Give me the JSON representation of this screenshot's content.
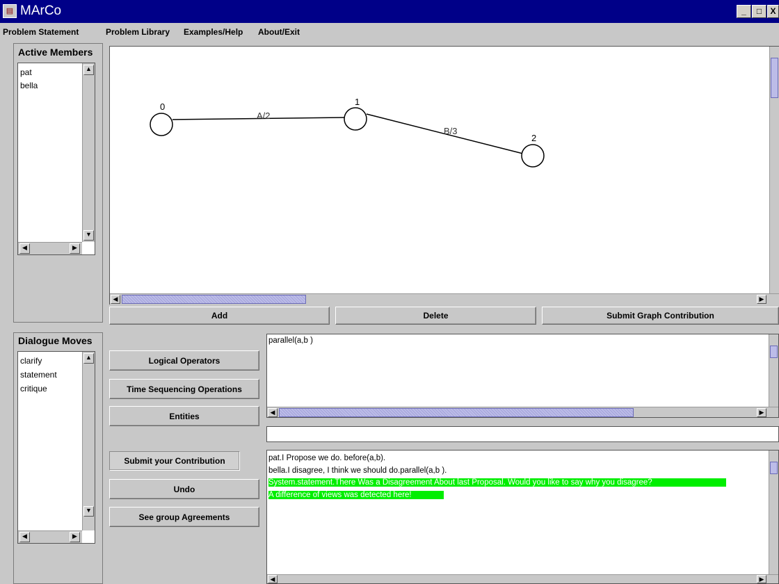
{
  "window": {
    "title": "MArCo",
    "buttons": {
      "minimize": "_",
      "maximize": "□",
      "close": "X"
    }
  },
  "menu": [
    "Problem Statement",
    "Problem Library",
    "Examples/Help",
    "About/Exit"
  ],
  "active_members": {
    "label": "Active Members",
    "items": [
      "pat",
      "bella"
    ]
  },
  "graph": {
    "nodes": [
      {
        "label": "0"
      },
      {
        "label": "1"
      },
      {
        "label": "2"
      }
    ],
    "edges": [
      {
        "label": "A/2",
        "from": "0",
        "to": "1"
      },
      {
        "label": "B/3",
        "from": "1",
        "to": "2"
      }
    ]
  },
  "graph_buttons": {
    "add": "Add",
    "delete": "Delete",
    "submit": "Submit Graph Contribution"
  },
  "dialogue_moves": {
    "label": "Dialogue Moves",
    "items": [
      "clarify",
      "statement",
      "critique"
    ]
  },
  "op_buttons": {
    "logical": "Logical Operators",
    "time": "Time Sequencing Operations",
    "entities": "Entities",
    "submit": "Submit your Contribution",
    "undo": "Undo",
    "agreements": "See group Agreements"
  },
  "expression": {
    "text": "parallel(a,b )"
  },
  "input_field": {
    "value": ""
  },
  "chat": {
    "lines": [
      {
        "text": "pat.I Propose we do. before(a,b).",
        "highlight": false
      },
      {
        "text": "bella.I disagree, I think we should do.parallel(a,b ).",
        "highlight": false
      },
      {
        "text": "System.statement.There Was a Disagreement About last Proposal. Would you like to say why you disagree?",
        "highlight": true
      },
      {
        "text": "A difference of views was detected here!",
        "highlight": true
      },
      {
        "text": " ",
        "highlight": true
      }
    ]
  },
  "colors": {
    "title_bar": "#000088",
    "highlight": "#00ee00",
    "scroll_thumb": "#bcbce8"
  }
}
